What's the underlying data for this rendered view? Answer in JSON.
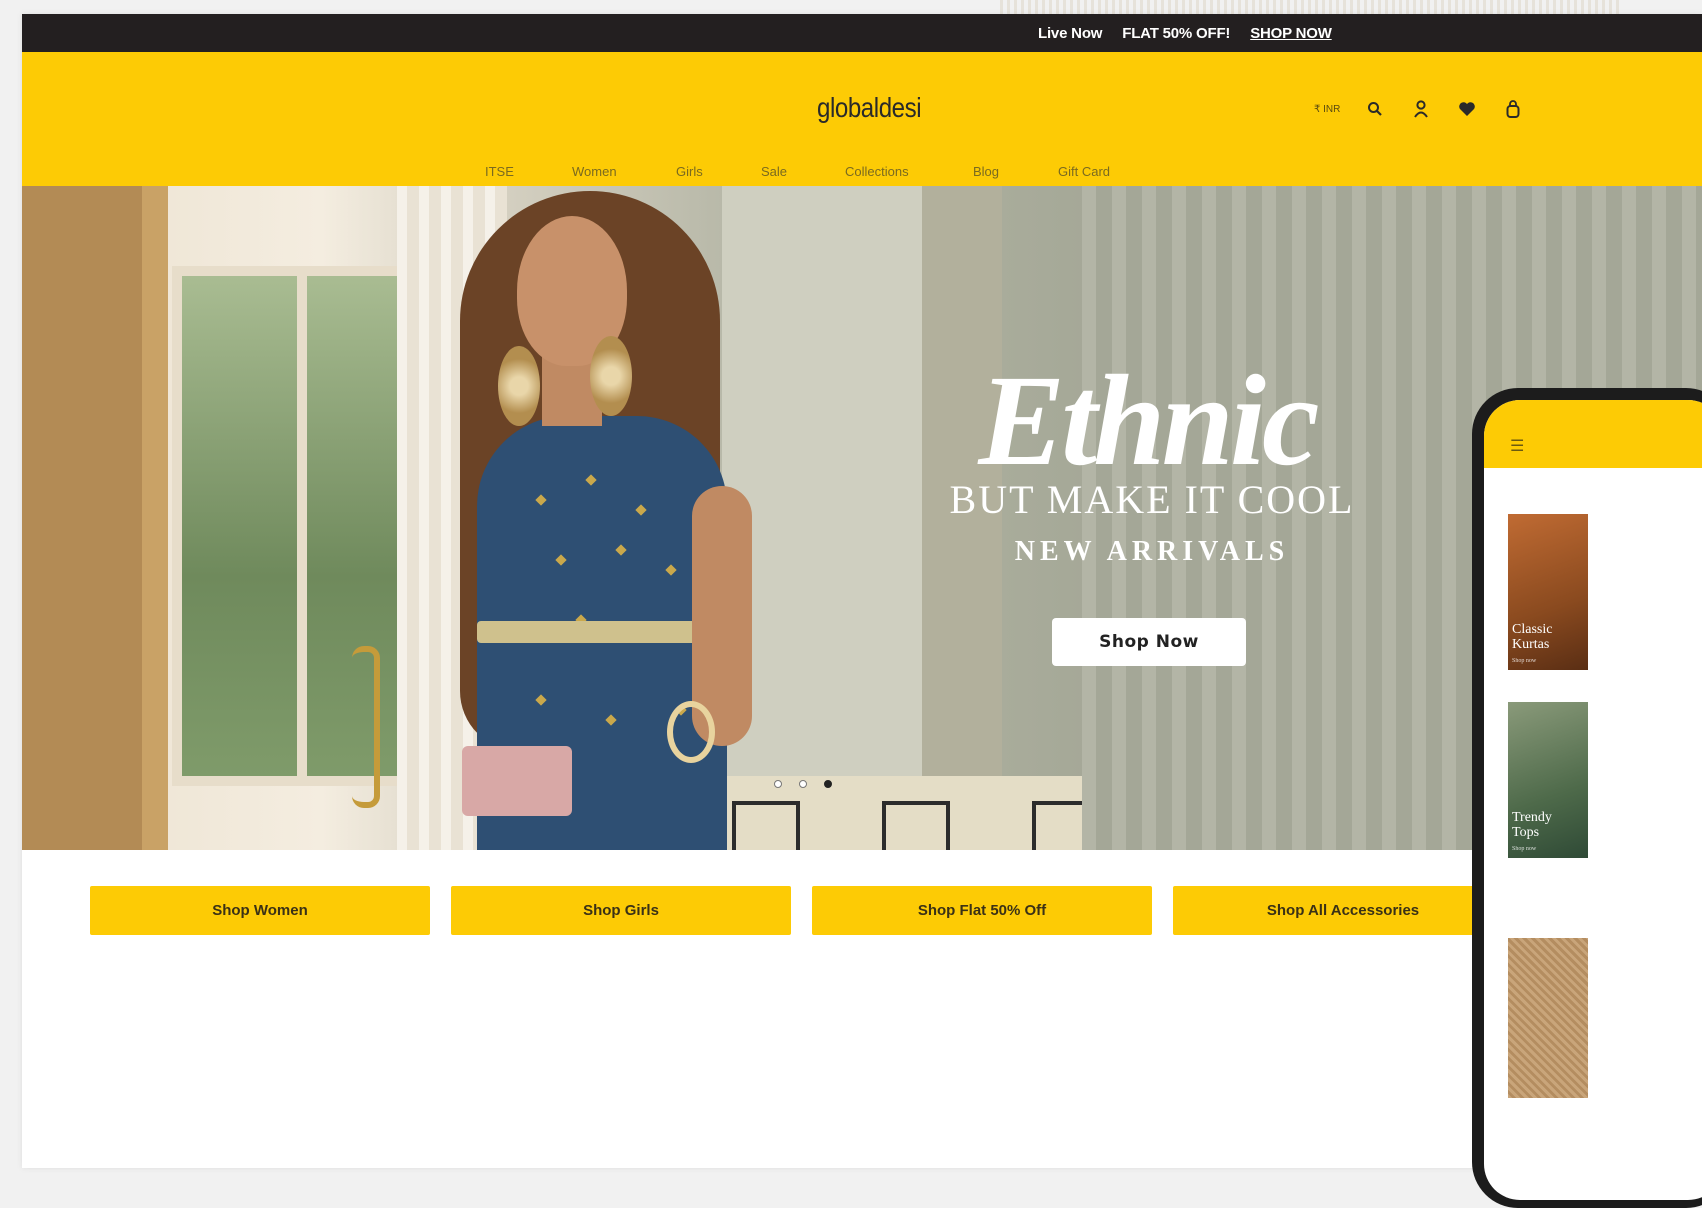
{
  "announcement": {
    "live": "Live Now",
    "offer": "FLAT 50% OFF!",
    "cta": "SHOP NOW"
  },
  "header": {
    "logo": "globaldesi",
    "currency": "₹ INR",
    "icons": [
      "search-icon",
      "user-icon",
      "wishlist-icon",
      "bag-icon"
    ]
  },
  "nav": {
    "items": [
      "ITSE",
      "Women",
      "Girls",
      "Sale",
      "Collections",
      "Blog",
      "Gift Card"
    ]
  },
  "hero": {
    "title": "Ethnic",
    "subtitle": "BUT MAKE IT COOL",
    "tagline": "NEW ARRIVALS",
    "cta": "Shop Now",
    "slides": 3,
    "active_slide": 3
  },
  "categories": [
    {
      "label": "Shop Women"
    },
    {
      "label": "Shop Girls"
    },
    {
      "label": "Shop Flat 50% Off"
    },
    {
      "label": "Shop All Accessories"
    }
  ],
  "phone": {
    "cards": [
      {
        "title_1": "Classic",
        "title_2": "Kurtas",
        "link": "Shop now"
      },
      {
        "title_1": "Trendy",
        "title_2": "Tops",
        "link": "Shop now"
      }
    ]
  },
  "colors": {
    "brand_yellow": "#fdcb05",
    "announce_bg": "#231f20"
  }
}
